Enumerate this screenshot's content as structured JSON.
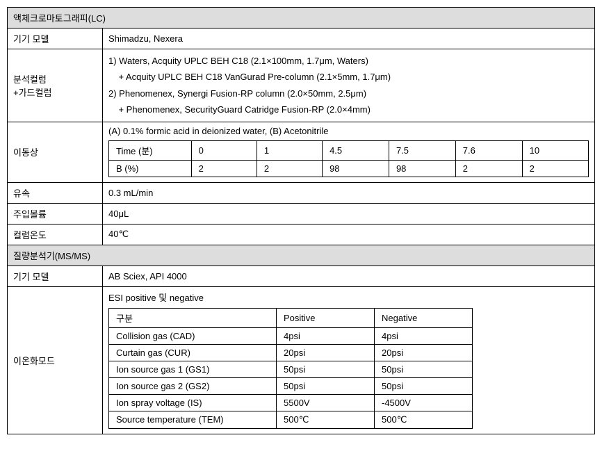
{
  "sections": {
    "lc": {
      "header": "액체크로마토그래피(LC)",
      "model_label": "기기 모델",
      "model_value": "Shimadzu, Nexera",
      "column_label": "분석컬럼\n+가드컬럼",
      "column_line1": "1) Waters, Acquity UPLC BEH C18 (2.1×100mm, 1.7μm, Waters)",
      "column_line2": "    + Acquity UPLC BEH C18 VanGurad Pre-column (2.1×5mm, 1.7μm)",
      "column_line3": "2) Phenomenex, Synergi Fusion-RP column (2.0×50mm, 2.5μm)",
      "column_line4": "    + Phenomenex, SecurityGuard Catridge Fusion-RP (2.0×4mm)",
      "mobile_label": "이동상",
      "mobile_value": "(A) 0.1% formic acid in deionized water, (B) Acetonitrile",
      "gradient": {
        "row1_label": "Time (분)",
        "row1_v0": "0",
        "row1_v1": "1",
        "row1_v2": "4.5",
        "row1_v3": "7.5",
        "row1_v4": "7.6",
        "row1_v5": "10",
        "row2_label": "B (%)",
        "row2_v0": "2",
        "row2_v1": "2",
        "row2_v2": "98",
        "row2_v3": "98",
        "row2_v4": "2",
        "row2_v5": "2"
      },
      "flow_label": "유속",
      "flow_value": "0.3 mL/min",
      "inj_label": "주입볼륨",
      "inj_value": "40μL",
      "temp_label": "컬럼온도",
      "temp_value": "40℃"
    },
    "ms": {
      "header": "질량분석기(MS/MS)",
      "model_label": "기기 모델",
      "model_value": "AB Sciex, API 4000",
      "ion_label": "이온화모드",
      "ion_value": "ESI positive 및 negative",
      "table": {
        "h1": "구분",
        "h2": "Positive",
        "h3": "Negative",
        "r1c1": "Collision gas (CAD)",
        "r1c2": "4psi",
        "r1c3": "4psi",
        "r2c1": "Curtain gas (CUR)",
        "r2c2": "20psi",
        "r2c3": "20psi",
        "r3c1": "Ion source gas 1 (GS1)",
        "r3c2": "50psi",
        "r3c3": "50psi",
        "r4c1": "Ion source gas 2 (GS2)",
        "r4c2": "50psi",
        "r4c3": "50psi",
        "r5c1": "Ion spray voltage (IS)",
        "r5c2": "5500V",
        "r5c3": "-4500V",
        "r6c1": "Source temperature (TEM)",
        "r6c2": "500℃",
        "r6c3": "500℃"
      }
    }
  }
}
